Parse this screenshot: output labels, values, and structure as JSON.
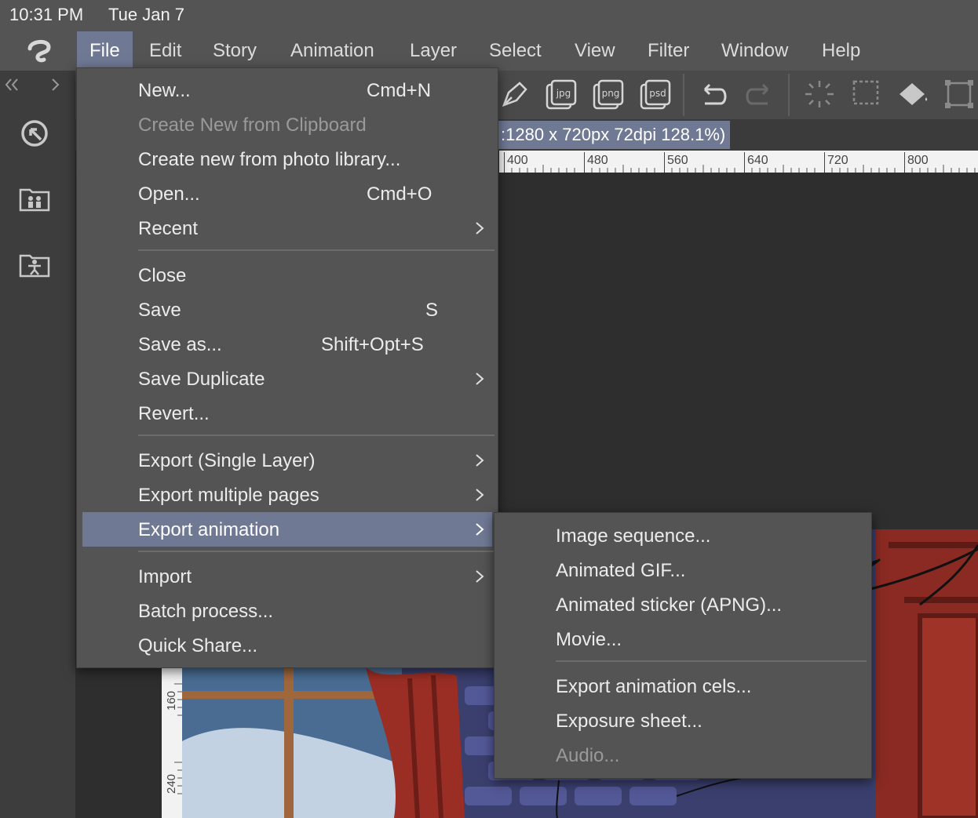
{
  "status": {
    "time": "10:31 PM",
    "date": "Tue Jan 7"
  },
  "menubar": {
    "items": [
      {
        "label": "File",
        "active": true
      },
      {
        "label": "Edit"
      },
      {
        "label": "Story"
      },
      {
        "label": "Animation"
      },
      {
        "label": "Layer"
      },
      {
        "label": "Select"
      },
      {
        "label": "View"
      },
      {
        "label": "Filter"
      },
      {
        "label": "Window"
      },
      {
        "label": "Help"
      }
    ]
  },
  "toolbar": {
    "export_labels": [
      "jpg",
      "png",
      "psd"
    ],
    "icons": [
      "pen-icon",
      "export-jpg-icon",
      "export-png-icon",
      "export-psd-icon",
      "undo-icon",
      "redo-icon",
      "loading-icon",
      "selection-icon",
      "fill-icon",
      "transform-icon"
    ]
  },
  "canvas": {
    "title": ":1280 x 720px 72dpi 128.1%)",
    "ruler_h": [
      "400",
      "480",
      "560",
      "640",
      "720",
      "800"
    ],
    "ruler_v": [
      "160",
      "240"
    ]
  },
  "file_menu": {
    "items": [
      {
        "label": "New...",
        "shortcut": "Cmd+N"
      },
      {
        "label": "Create New from Clipboard",
        "disabled": true
      },
      {
        "label": "Create new from photo library..."
      },
      {
        "label": "Open...",
        "shortcut": "Cmd+O"
      },
      {
        "label": "Recent",
        "submenu": true
      },
      {
        "label": "Close"
      },
      {
        "label": "Save",
        "shortcut": "S"
      },
      {
        "label": "Save as...",
        "shortcut": "Shift+Opt+S"
      },
      {
        "label": "Save Duplicate",
        "submenu": true
      },
      {
        "label": "Revert..."
      },
      {
        "label": "Export (Single Layer)",
        "submenu": true
      },
      {
        "label": "Export multiple pages",
        "submenu": true
      },
      {
        "label": "Export animation",
        "submenu": true,
        "highlighted": true
      },
      {
        "label": "Import",
        "submenu": true
      },
      {
        "label": "Batch process..."
      },
      {
        "label": "Quick Share..."
      }
    ]
  },
  "export_animation_menu": {
    "items": [
      {
        "label": "Image sequence..."
      },
      {
        "label": "Animated GIF..."
      },
      {
        "label": "Animated sticker (APNG)..."
      },
      {
        "label": "Movie..."
      },
      {
        "label": "Export animation cels..."
      },
      {
        "label": "Exposure sheet..."
      },
      {
        "label": "Audio...",
        "disabled": true
      }
    ]
  },
  "colors": {
    "menu_bg": "#545454",
    "highlight": "#6f7994",
    "disabled_text": "#9a9a9a"
  }
}
